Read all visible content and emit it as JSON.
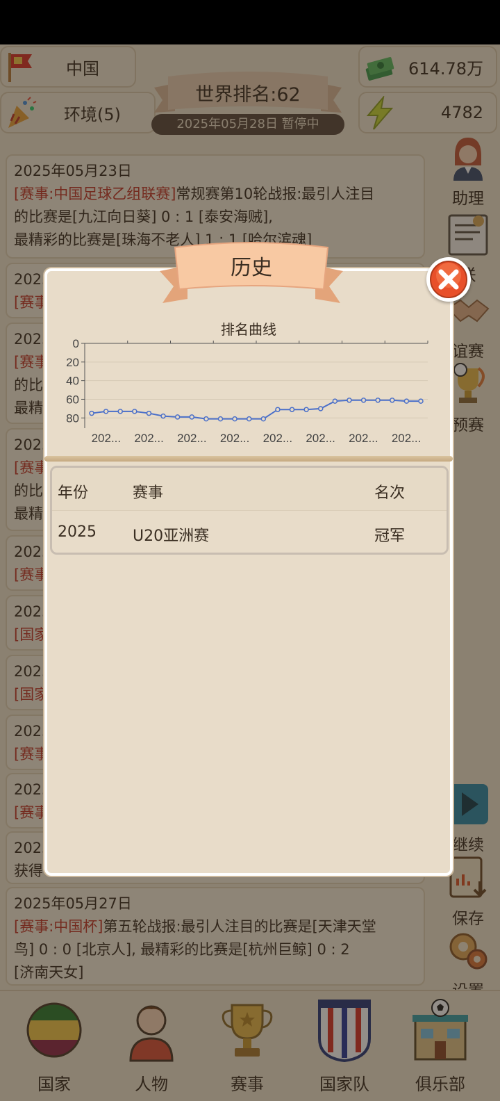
{
  "header": {
    "country": "中国",
    "environment": "环境(5)",
    "money": "614.78万",
    "energy": "4782",
    "world_rank": "世界排名:62",
    "date_status": "2025年05月28日 暂停中"
  },
  "feed": [
    {
      "lines": [
        [
          {
            "t": "2025年05月23日"
          }
        ],
        [
          {
            "t": "[赛事:中国足球乙组联赛]",
            "red": true
          },
          {
            "t": "常规赛第10轮战报:最引人注目"
          }
        ],
        [
          {
            "t": "的比赛是[九江向日葵] 0 : 1 [泰安海贼],"
          }
        ],
        [
          {
            "t": "最精彩的比赛是[珠海不老人] 1 : 1 [哈尔滨魂]"
          }
        ]
      ]
    },
    {
      "lines": [
        [
          {
            "t": "2025"
          }
        ],
        [
          {
            "t": "[赛事",
            "red": true
          }
        ]
      ]
    },
    {
      "lines": [
        [
          {
            "t": "2025"
          }
        ],
        [
          {
            "t": "[赛事",
            "red": true
          }
        ],
        [
          {
            "t": "的比"
          }
        ],
        [
          {
            "t": "最精"
          }
        ]
      ]
    },
    {
      "lines": [
        [
          {
            "t": "2025"
          }
        ],
        [
          {
            "t": "[赛事",
            "red": true
          }
        ],
        [
          {
            "t": "的比"
          }
        ],
        [
          {
            "t": "最精"
          }
        ]
      ]
    },
    {
      "lines": [
        [
          {
            "t": "2025"
          }
        ],
        [
          {
            "t": "[赛事",
            "red": true
          }
        ]
      ]
    },
    {
      "lines": [
        [
          {
            "t": "2025"
          }
        ],
        [
          {
            "t": "[国家",
            "red": true
          }
        ]
      ]
    },
    {
      "lines": [
        [
          {
            "t": "2025"
          }
        ],
        [
          {
            "t": "[国家",
            "red": true
          }
        ]
      ]
    },
    {
      "lines": [
        [
          {
            "t": "2025"
          }
        ],
        [
          {
            "t": "[赛事",
            "red": true
          }
        ]
      ]
    },
    {
      "lines": [
        [
          {
            "t": "2025"
          }
        ],
        [
          {
            "t": "[赛事",
            "red": true
          }
        ]
      ]
    },
    {
      "lines": [
        [
          {
            "t": "2025"
          }
        ],
        [
          {
            "t": "获得"
          }
        ]
      ]
    },
    {
      "lines": [
        [
          {
            "t": "2025年05月27日"
          }
        ],
        [
          {
            "t": "[赛事:中国杯]",
            "red": true
          },
          {
            "t": "第五轮战报:最引人注目的比赛是[天津天堂"
          }
        ],
        [
          {
            "t": "鸟] 0 : 0 [北京人], 最精彩的比赛是[杭州巨鲸] 0 : 2"
          }
        ],
        [
          {
            "t": "[济南天女]"
          }
        ]
      ]
    }
  ],
  "side": {
    "assistant": "助理",
    "league": "联",
    "friendly": "谊赛",
    "qualifier": "预赛",
    "continue": "继续",
    "save": "保存",
    "settings": "设置"
  },
  "bottom_nav": {
    "country": "国家",
    "people": "人物",
    "competitions": "赛事",
    "national_team": "国家队",
    "club": "俱乐部"
  },
  "modal": {
    "title": "历史",
    "table": {
      "headers": [
        "年份",
        "赛事",
        "名次"
      ],
      "rows": [
        [
          "2025",
          "U20亚洲赛",
          "冠军"
        ]
      ]
    }
  },
  "chart_data": {
    "type": "line",
    "title": "排名曲线",
    "xlabel": "",
    "ylabel": "",
    "x_tick_labels": [
      "202...",
      "202...",
      "202...",
      "202...",
      "202...",
      "202...",
      "202...",
      "202..."
    ],
    "y_ticks": [
      0,
      20,
      40,
      60,
      80
    ],
    "ylim": [
      0,
      88
    ],
    "y_inverted": true,
    "grid": true,
    "series": [
      {
        "values": [
          75,
          73,
          73,
          73,
          75,
          78,
          79,
          79,
          81,
          81,
          81,
          81,
          81,
          71,
          71,
          71,
          70,
          62,
          61,
          61,
          61,
          61,
          62,
          62
        ],
        "color": "#4a6fc9"
      }
    ]
  },
  "colors": {
    "accent_red": "#c0392b",
    "line_blue": "#4a6fc9",
    "panel_bg": "#e8dcc9"
  }
}
